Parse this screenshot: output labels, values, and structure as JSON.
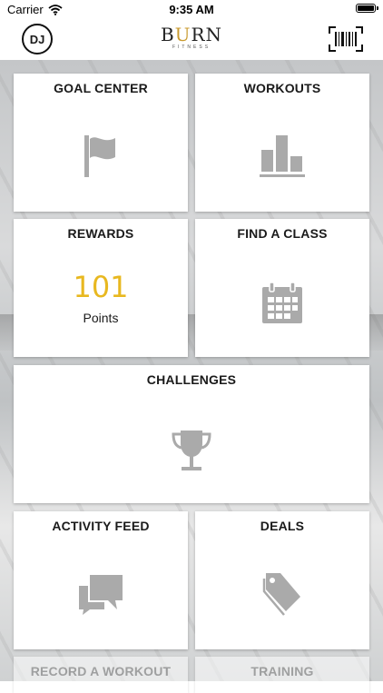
{
  "status_bar": {
    "carrier": "Carrier",
    "time": "9:35 AM"
  },
  "header": {
    "avatar_initials": "DJ",
    "logo_text_1": "B",
    "logo_text_u": "U",
    "logo_text_2": "RN",
    "logo_subtext": "FITNESS"
  },
  "tiles": {
    "goal_center": {
      "title": "GOAL CENTER",
      "icon": "flag-icon"
    },
    "workouts": {
      "title": "WORKOUTS",
      "icon": "bar-chart-icon"
    },
    "rewards": {
      "title": "REWARDS",
      "points_value": "101",
      "points_label": "Points"
    },
    "find_a_class": {
      "title": "FIND A CLASS",
      "icon": "calendar-icon"
    },
    "challenges": {
      "title": "CHALLENGES",
      "icon": "trophy-icon"
    },
    "activity_feed": {
      "title": "ACTIVITY FEED",
      "icon": "chat-bubbles-icon"
    },
    "deals": {
      "title": "DEALS",
      "icon": "tag-icon"
    },
    "record_a_workout": {
      "title": "RECORD A WORKOUT"
    },
    "training": {
      "title": "TRAINING"
    }
  },
  "colors": {
    "accent": "#e8b820",
    "icon_gray": "#aaaaaa",
    "logo_gold": "#c99a2e"
  }
}
